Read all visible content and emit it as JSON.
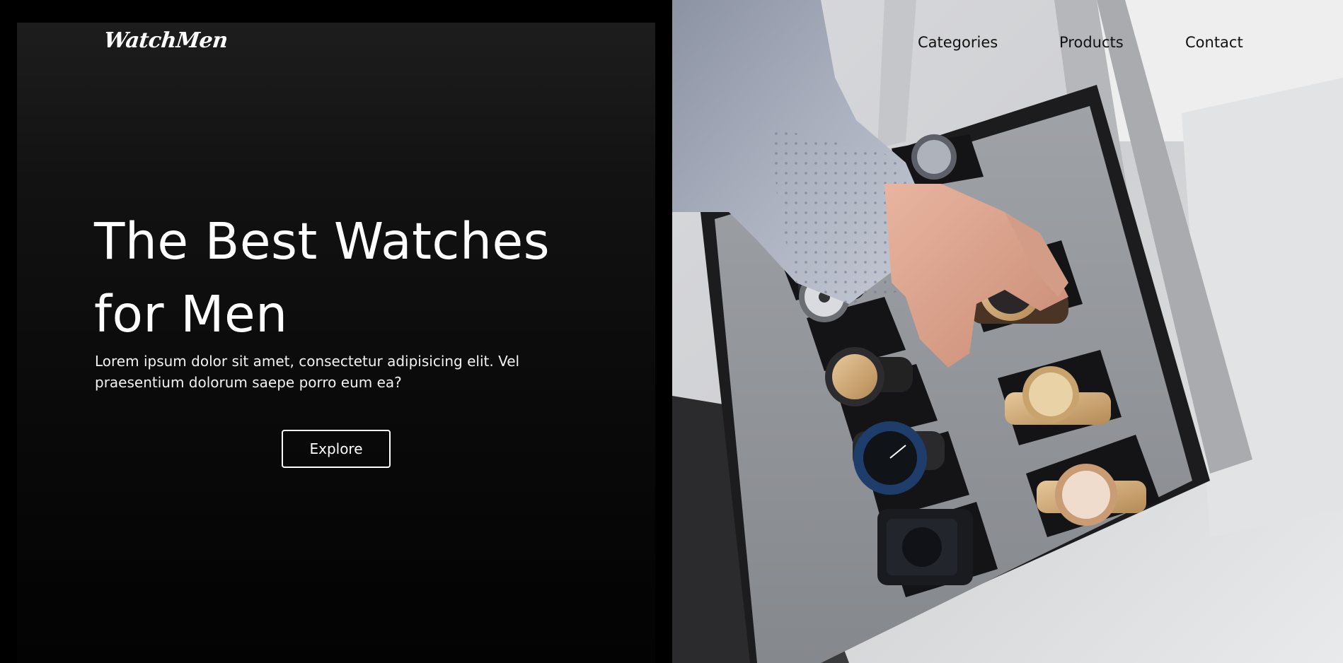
{
  "brand": {
    "logo_text": "WatchMen"
  },
  "nav": {
    "items": [
      {
        "label": "Categories"
      },
      {
        "label": "Products"
      },
      {
        "label": "Contact"
      }
    ]
  },
  "hero": {
    "title_line1": "The Best Watches",
    "title_line2": "for Men",
    "subtitle": "Lorem ipsum dolor sit amet, consectetur adipisicing elit. Vel praesentium dolorum saepe porro eum ea?",
    "cta_label": "Explore"
  },
  "image": {
    "subject": "hand-picking-watch-from-display-case-icon"
  },
  "colors": {
    "background": "#000000",
    "panel_top": "#1d1d1d",
    "text": "#ffffff",
    "nav_text": "#111111"
  }
}
